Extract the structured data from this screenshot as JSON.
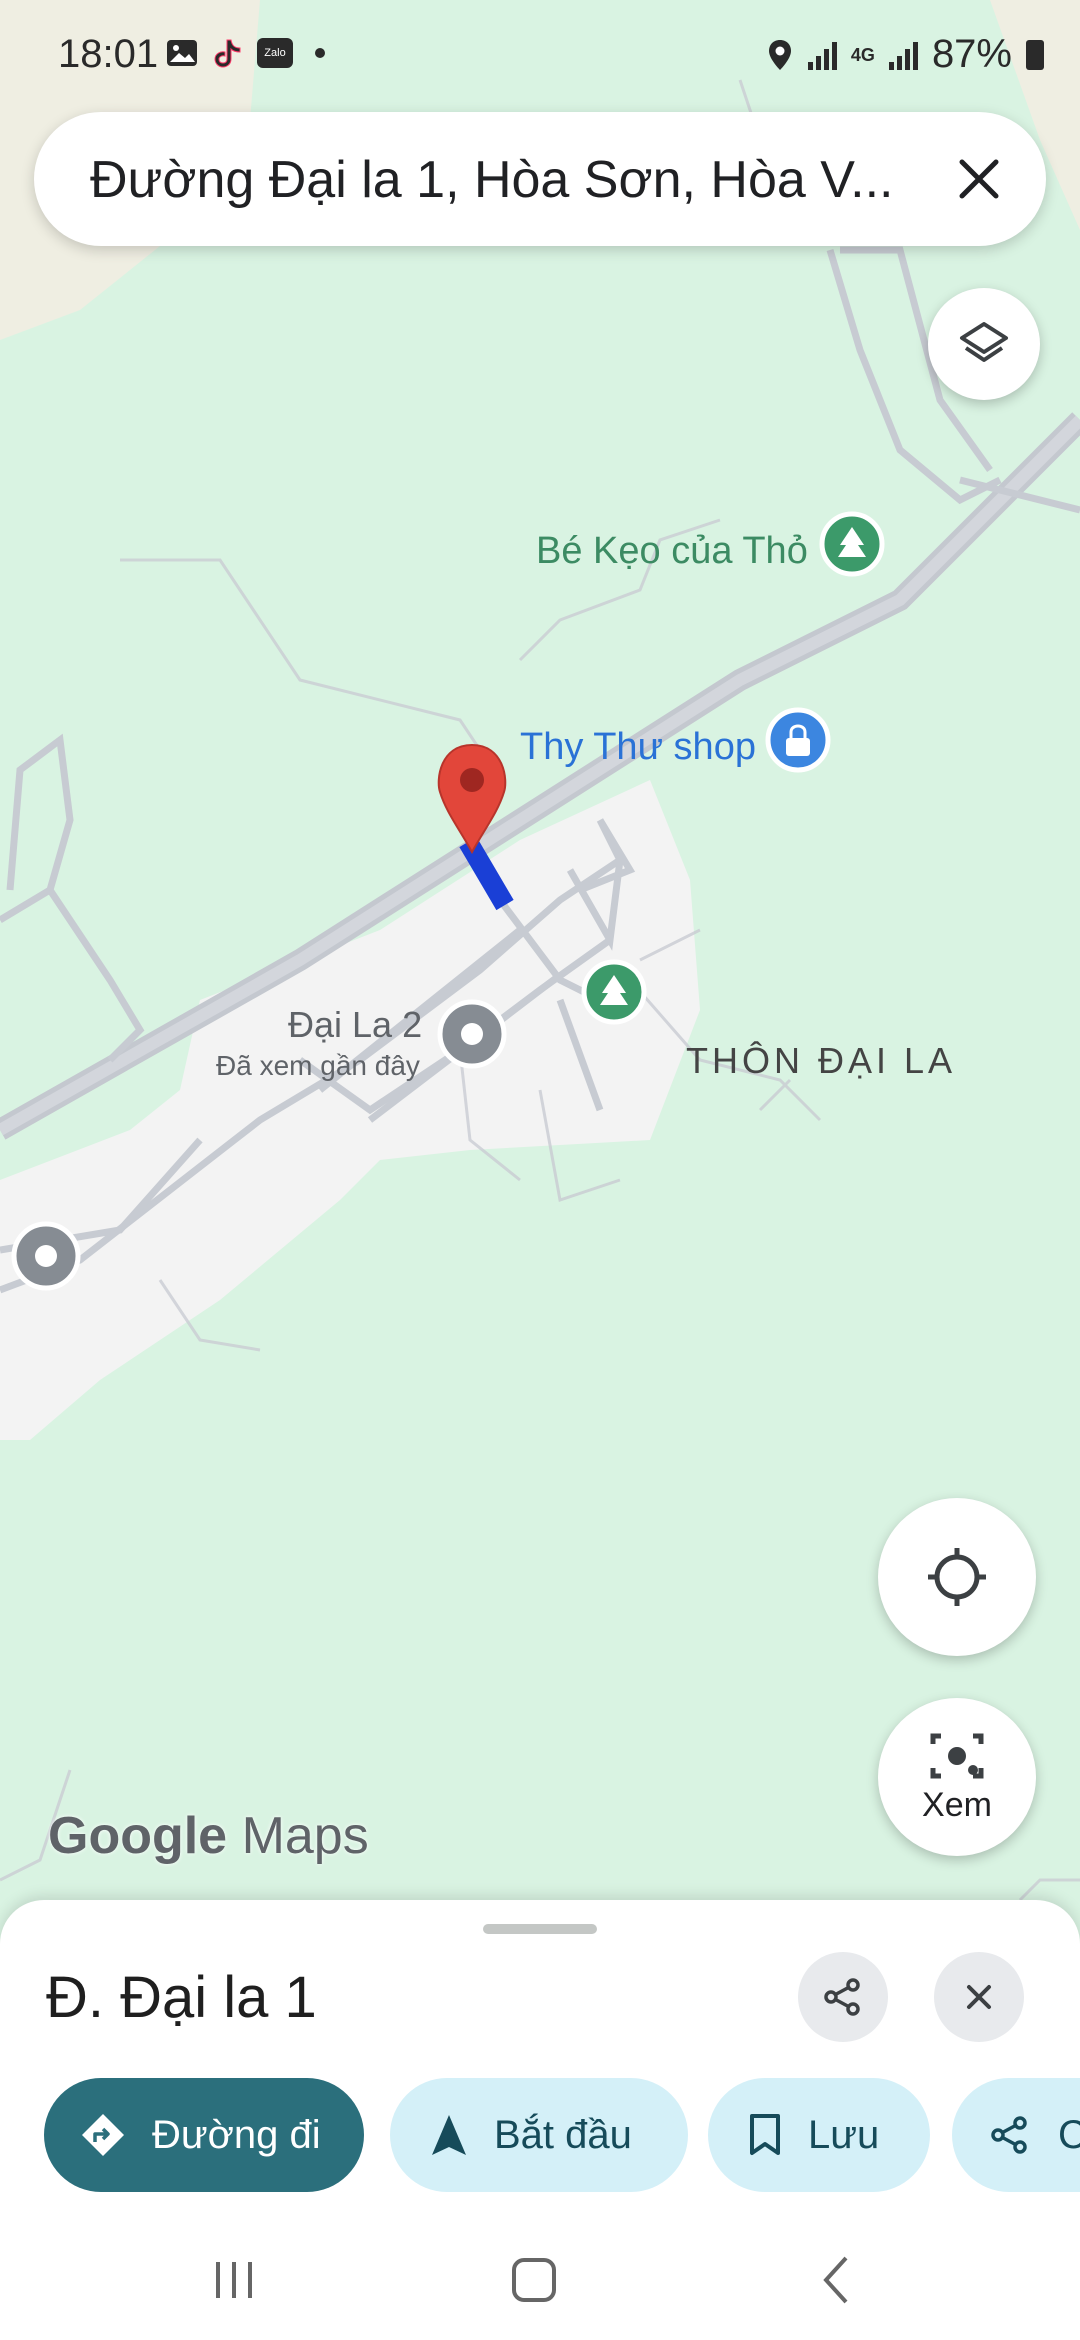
{
  "status_bar": {
    "time": "18:01",
    "app_icons": [
      "image-icon",
      "tiktok-icon",
      "zalo-icon"
    ],
    "zalo_label": "Zalo",
    "network": "4G",
    "battery": "87%"
  },
  "search": {
    "query": "Đường Đại la 1, Hòa Sơn, Hòa V..."
  },
  "map": {
    "places": {
      "be_keo": "Bé Kẹo của Thỏ",
      "thy_thu_shop": "Thy Thư shop",
      "dai_la_2": "Đại La 2",
      "dai_la_2_sub": "Đã xem gần đây",
      "thon_dai_la": "THÔN ĐẠI LA"
    },
    "logo": {
      "google": "Google",
      "maps": "Maps"
    },
    "colors": {
      "land": "#d9f3e2",
      "urban": "#f2f2f2",
      "road": "#c9ccd3",
      "highlight": "#1a3fd6",
      "pin": "#e2463a"
    }
  },
  "controls": {
    "lens_label": "Xem"
  },
  "sheet": {
    "title": "Đ. Đại la 1",
    "chips": {
      "directions": "Đường đi",
      "start": "Bắt đầu",
      "save": "Lưu",
      "share": "C"
    },
    "accent": "#2b6f7c",
    "chip_bg": "#d4f0f8"
  }
}
